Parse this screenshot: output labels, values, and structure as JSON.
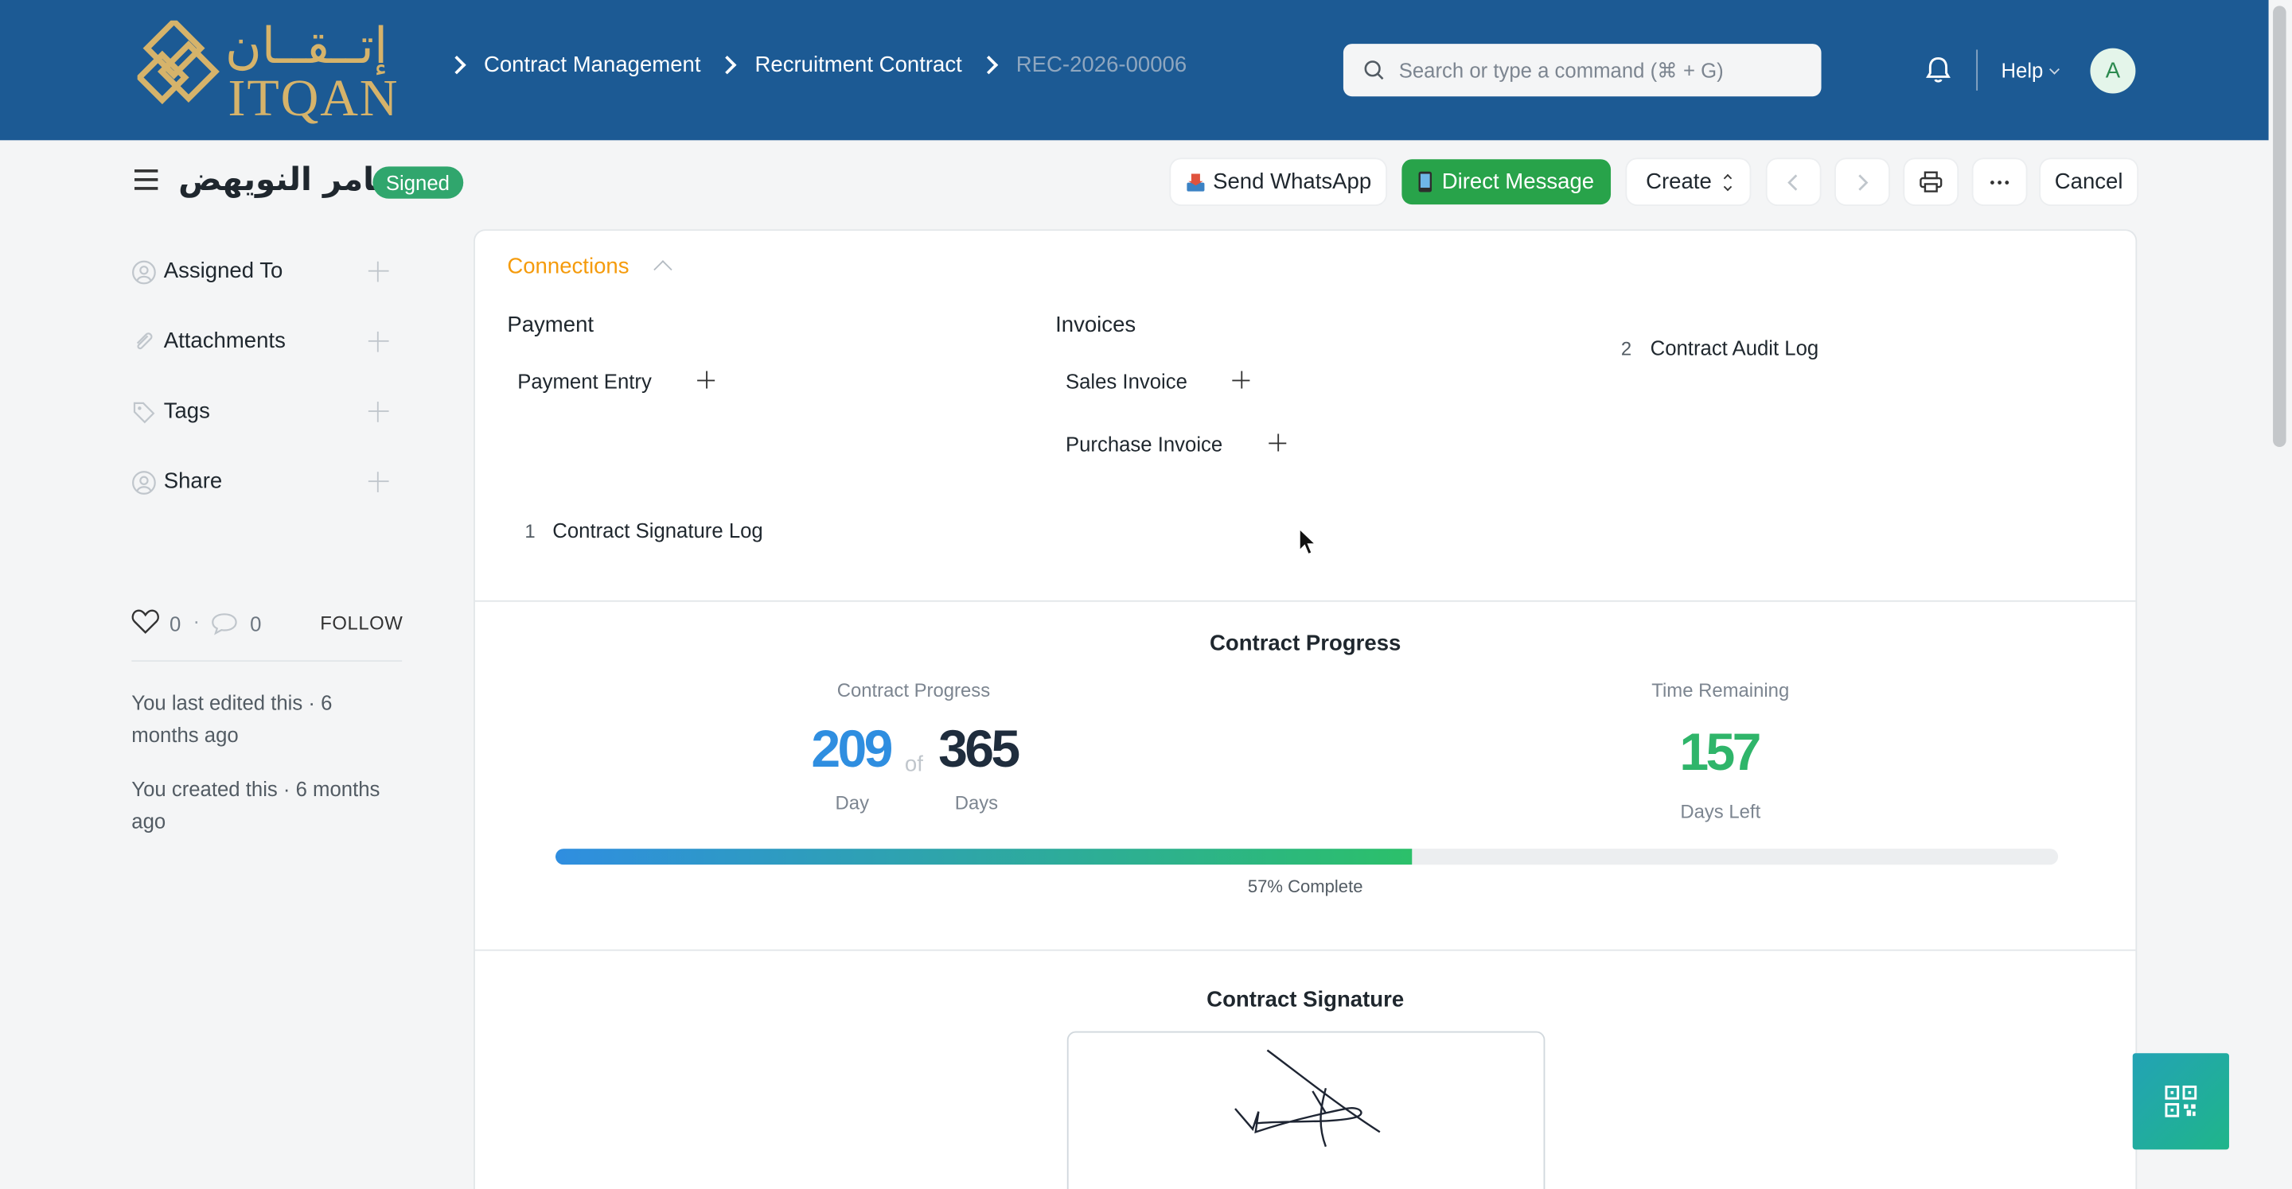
{
  "navbar": {
    "logo_arabic": "إتــقــان",
    "logo_latin": "ITQAN",
    "breadcrumbs": [
      "Contract Management",
      "Recruitment Contract"
    ],
    "current_doc": "REC-2026-00006",
    "search_placeholder": "Search or type a command (⌘ + G)",
    "help_label": "Help",
    "avatar_initial": "A"
  },
  "header": {
    "title": "ثامر النويهض",
    "status": "Signed",
    "buttons": {
      "whatsapp": "Send WhatsApp",
      "direct_message": "Direct Message",
      "create": "Create",
      "cancel": "Cancel"
    }
  },
  "sidebar": {
    "items": [
      {
        "label": "Assigned To",
        "icon": "user-icon"
      },
      {
        "label": "Attachments",
        "icon": "paperclip-icon"
      },
      {
        "label": "Tags",
        "icon": "tag-icon"
      },
      {
        "label": "Share",
        "icon": "share-user-icon"
      }
    ],
    "likes": "0",
    "comments": "0",
    "follow": "FOLLOW",
    "last_edited": "You last edited this · 6 months ago",
    "created": "You created this · 6 months ago"
  },
  "connections": {
    "title": "Connections",
    "groups": {
      "payment": {
        "title": "Payment",
        "items": [
          "Payment Entry"
        ]
      },
      "invoices": {
        "title": "Invoices",
        "items": [
          "Sales Invoice",
          "Purchase Invoice"
        ]
      }
    },
    "counted_links": [
      {
        "count": "1",
        "label": "Contract Signature Log"
      },
      {
        "count": "2",
        "label": "Contract Audit Log"
      }
    ]
  },
  "progress": {
    "section_title": "Contract Progress",
    "progress_label": "Contract Progress",
    "current_day": "209",
    "of": "of",
    "total_days": "365",
    "day_unit": "Day",
    "days_unit": "Days",
    "remaining_label": "Time Remaining",
    "days_left": "157",
    "days_left_unit": "Days Left",
    "percent": 57,
    "percent_label": "57% Complete"
  },
  "signature": {
    "section_title": "Contract Signature"
  },
  "colors": {
    "navbar": "#1c5a94",
    "accent_orange": "#f59b0c",
    "green": "#28a34a",
    "progress_blue": "#2f8ee0",
    "progress_green": "#2cc06a",
    "logo_gold": "#d6b36a"
  }
}
